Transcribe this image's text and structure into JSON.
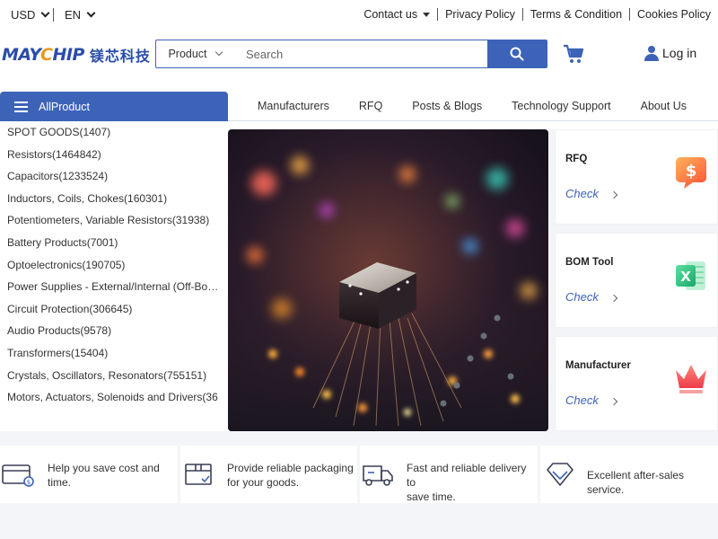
{
  "topbar": {
    "currency": "USD",
    "language": "EN",
    "links": [
      "Contact us",
      "Privacy Policy",
      "Terms & Condition",
      "Cookies Policy"
    ]
  },
  "logo": {
    "latin_a": "MAY",
    "latin_b": "C",
    "latin_c": "HIP",
    "chinese": "镁芯科技"
  },
  "search": {
    "category": "Product",
    "placeholder": "Search"
  },
  "header": {
    "login": "Log in"
  },
  "nav": {
    "all_product": "AllProduct",
    "items": [
      "Manufacturers",
      "RFQ",
      "Posts & Blogs",
      "Technology Support",
      "About Us"
    ]
  },
  "categories": [
    "SPOT GOODS(1407)",
    "Resistors(1464842)",
    "Capacitors(1233524)",
    "Inductors, Coils, Chokes(160301)",
    "Potentiometers, Variable Resistors(31938)",
    "Battery Products(7001)",
    "Optoelectronics(190705)",
    "Power Supplies - External/Internal (Off-Board)",
    "Circuit Protection(306645)",
    "Audio Products(9578)",
    "Transformers(15404)",
    "Crystals, Oscillators, Resonators(755151)",
    "Motors, Actuators, Solenoids and Drivers(36"
  ],
  "side_cards": [
    {
      "title": "RFQ",
      "link": "Check",
      "icon": "dollar-chat-icon"
    },
    {
      "title": "BOM Tool",
      "link": "Check",
      "icon": "excel-icon"
    },
    {
      "title": "Manufacturer",
      "link": "Check",
      "icon": "crown-icon"
    }
  ],
  "features": [
    {
      "icon": "card-icon",
      "line1": "Help you save cost and",
      "line2": "time."
    },
    {
      "icon": "package-icon",
      "line1": "Provide reliable packaging",
      "line2": "for your goods."
    },
    {
      "icon": "truck-icon",
      "line1": "Fast and reliable delivery to",
      "line2": "save time."
    },
    {
      "icon": "diamond-icon",
      "line1": "Excellent after-sales service.",
      "line2": ""
    }
  ],
  "colors": {
    "brand_blue": "#3d63b8",
    "accent_orange": "#e89a1f",
    "strip_bg": "#f4f5f9"
  }
}
